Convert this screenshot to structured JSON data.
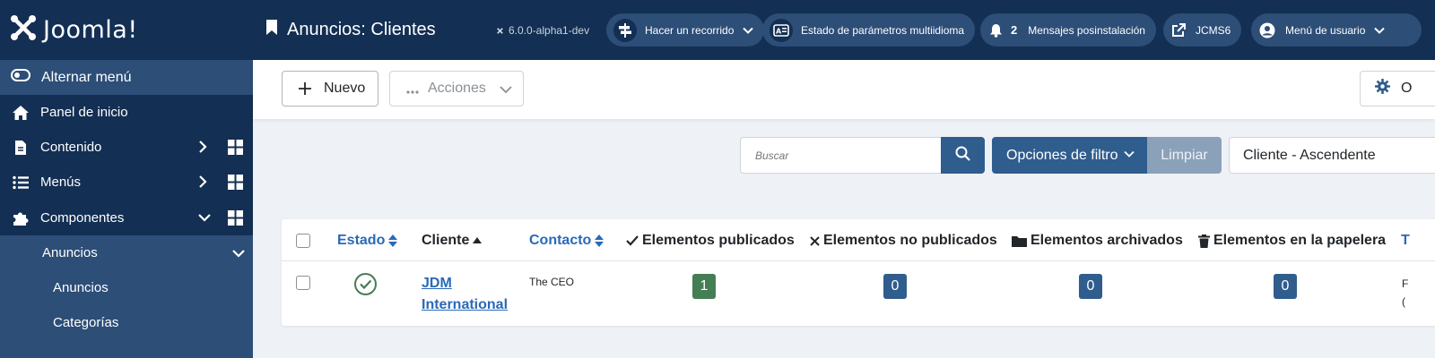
{
  "brand": {
    "name": "Joomla!",
    "logo_icon": "joomla-logo-icon"
  },
  "sidebar": {
    "toggle_label": "Alternar menú",
    "items": [
      {
        "label": "Panel de inicio",
        "icon": "home-icon"
      },
      {
        "label": "Contenido",
        "icon": "file-icon"
      },
      {
        "label": "Menús",
        "icon": "list-icon"
      },
      {
        "label": "Componentes",
        "icon": "puzzle-icon"
      }
    ],
    "submenu": {
      "group_label": "Anuncios",
      "items": [
        {
          "label": "Anuncios"
        },
        {
          "label": "Categorías"
        }
      ]
    }
  },
  "header": {
    "title": "Anuncios: Clientes",
    "version": "6.0.0-alpha1-dev",
    "tour_label": "Hacer un recorrido",
    "multilang_label": "Estado de parámetros multiidioma",
    "postinstall_count": "2",
    "postinstall_label": "Mensajes posinstalación",
    "site_label": "JCMS6",
    "user_menu_label": "Menú de usuario"
  },
  "toolbar": {
    "new_label": "Nuevo",
    "actions_label": "Acciones",
    "options_label": "O"
  },
  "filters": {
    "search_placeholder": "Buscar",
    "filter_options_label": "Opciones de filtro",
    "clear_label": "Limpiar",
    "sort_value": "Cliente - Ascendente"
  },
  "table": {
    "columns": {
      "status": "Estado",
      "client": "Cliente",
      "contact": "Contacto",
      "published": "Elementos publicados",
      "unpublished": "Elementos no publicados",
      "archived": "Elementos archivados",
      "trashed": "Elementos en la papelera",
      "next": "T"
    },
    "rows": [
      {
        "client_line1": "JDM",
        "client_line2": "International",
        "contact": "The CEO",
        "published": "1",
        "unpublished": "0",
        "archived": "0",
        "trashed": "0",
        "edge_line1": "F",
        "edge_line2": "("
      }
    ]
  },
  "colors": {
    "sidebar_bg": "#132f53",
    "accent": "#2f5d8d",
    "link": "#2a69b8",
    "success": "#457d54"
  }
}
